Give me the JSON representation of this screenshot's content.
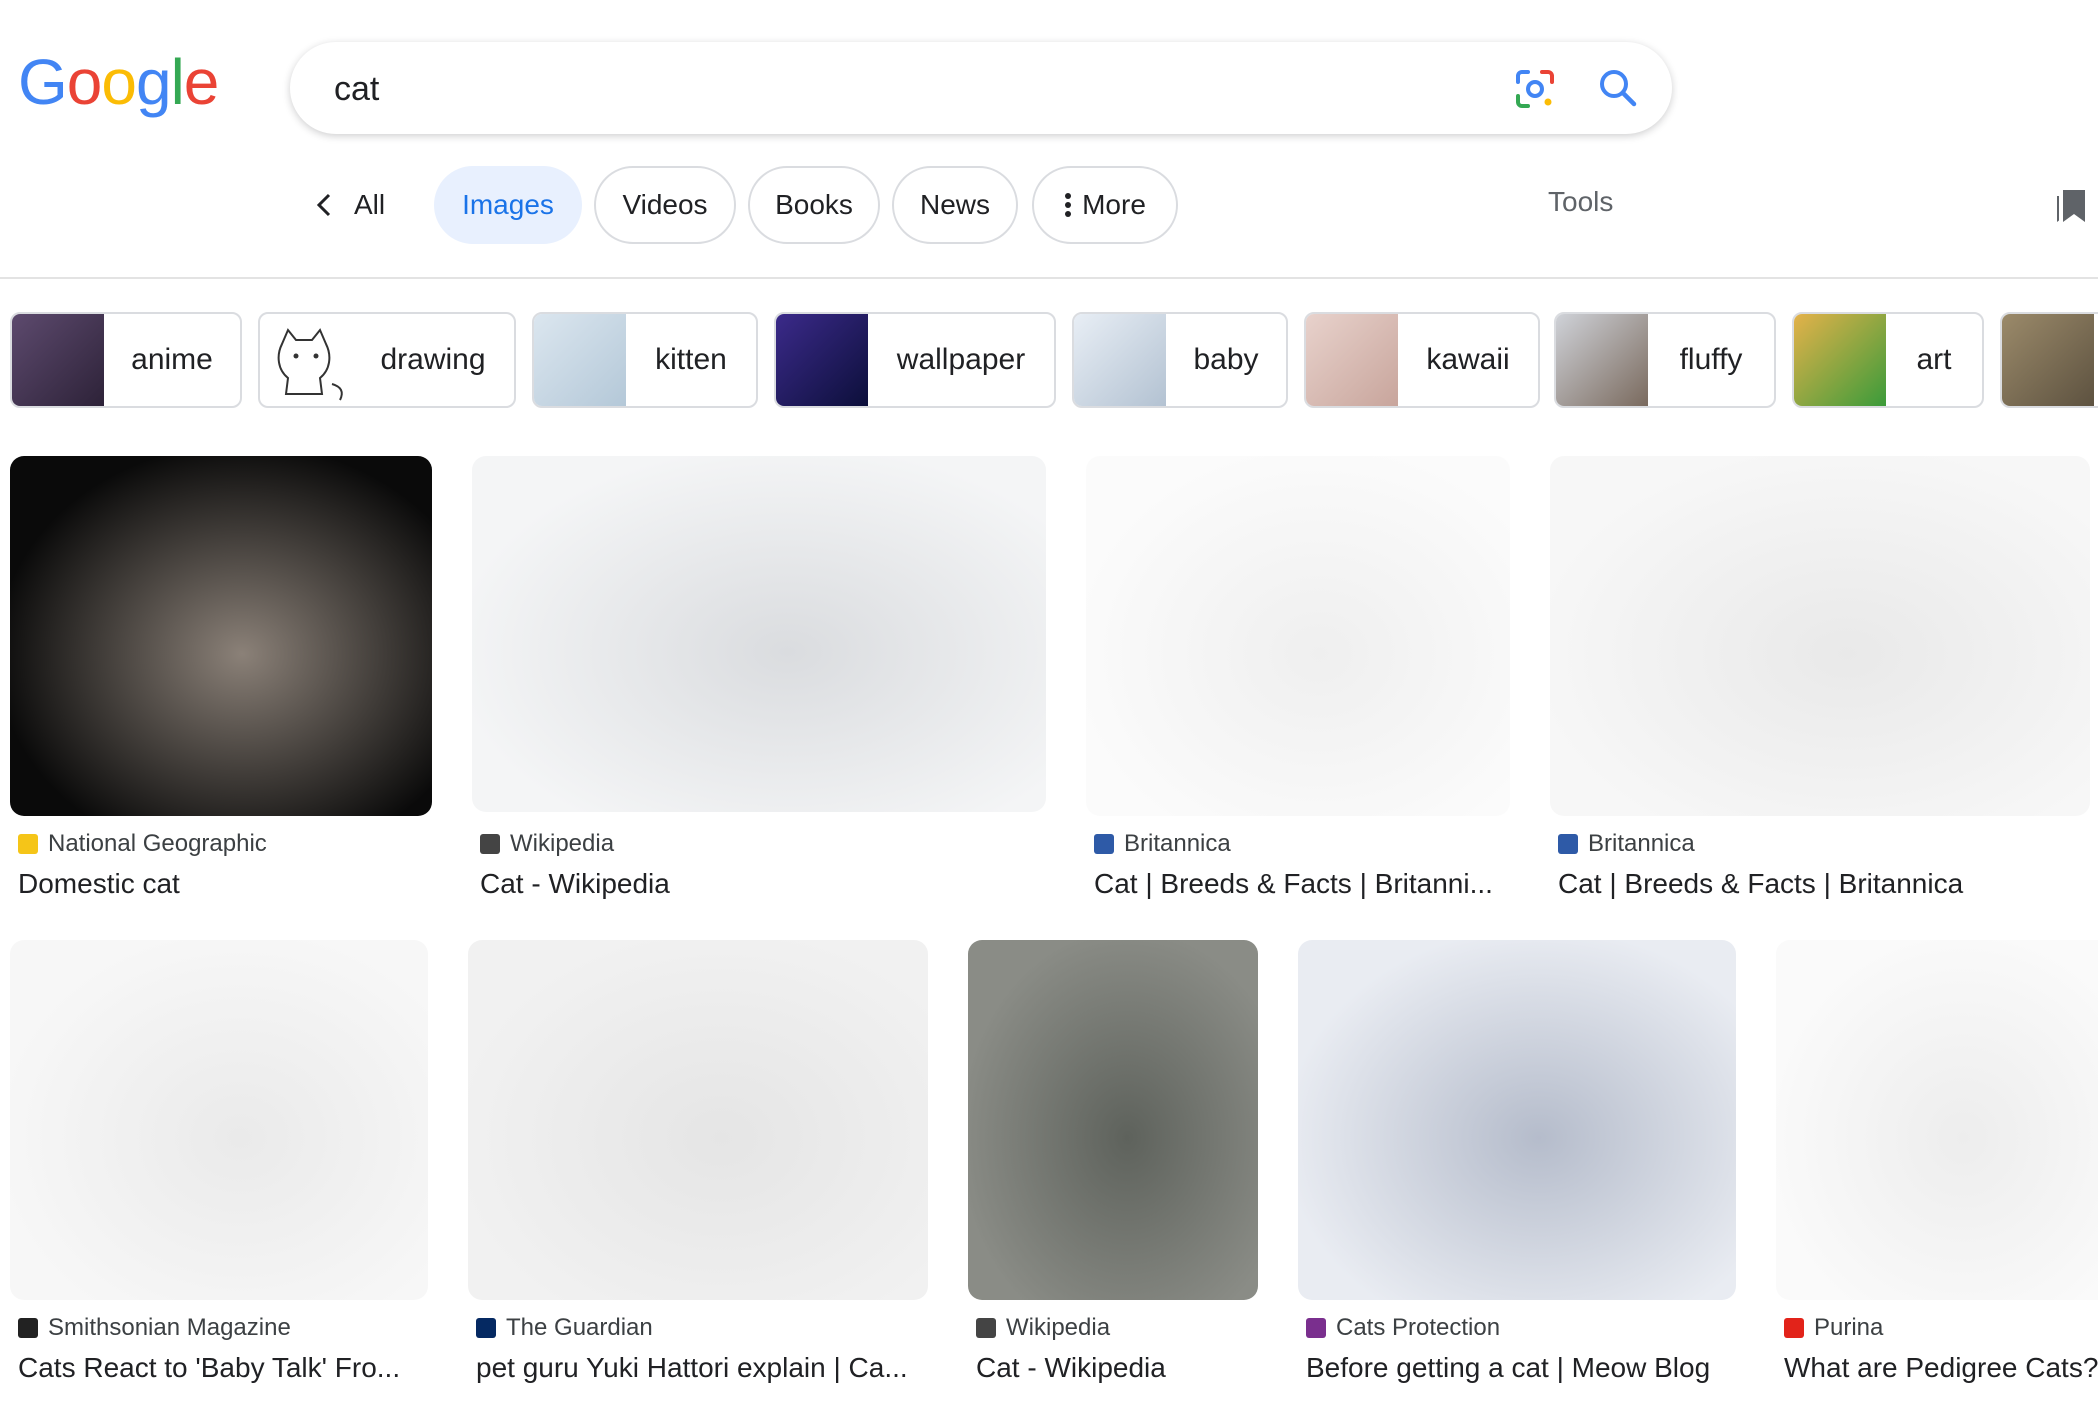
{
  "logo": {
    "letters": [
      "G",
      "o",
      "o",
      "g",
      "l",
      "e"
    ],
    "colors": [
      "#4285F4",
      "#EA4335",
      "#FBBC05",
      "#4285F4",
      "#34A853",
      "#EA4335"
    ]
  },
  "search": {
    "query": "cat"
  },
  "nav": {
    "back_all": "All",
    "tabs": [
      "Images",
      "Videos",
      "Books",
      "News",
      "More"
    ],
    "active": "Images",
    "tools": "Tools"
  },
  "chips": [
    {
      "label": "anime",
      "thumb_colors": [
        "#5d4a6e",
        "#2d2238"
      ]
    },
    {
      "label": "drawing",
      "thumb_colors": [
        "#ffffff",
        "#f1f1f1"
      ]
    },
    {
      "label": "kitten",
      "thumb_colors": [
        "#dbe6ef",
        "#b4c8d8"
      ]
    },
    {
      "label": "wallpaper",
      "thumb_colors": [
        "#3b2a8a",
        "#0c0f3a"
      ]
    },
    {
      "label": "baby",
      "thumb_colors": [
        "#e8eef5",
        "#b3c2d2"
      ]
    },
    {
      "label": "kawaii",
      "thumb_colors": [
        "#e8d2cc",
        "#c8a59c"
      ]
    },
    {
      "label": "fluffy",
      "thumb_colors": [
        "#cfd2d8",
        "#7a6a5e"
      ]
    },
    {
      "label": "art",
      "thumb_colors": [
        "#e4b24a",
        "#3b9b3a"
      ]
    },
    {
      "label": "",
      "thumb_colors": [
        "#9b8a6a",
        "#5d5240"
      ]
    }
  ],
  "results": [
    {
      "source": "National Geographic",
      "title": "Domestic cat",
      "icon_color": "#f5c518",
      "img_colors": [
        "#0a0a0a",
        "#8b8178"
      ]
    },
    {
      "source": "Wikipedia",
      "title": "Cat - Wikipedia",
      "icon_color": "#444444",
      "img_colors": [
        "#f4f5f6",
        "#dadcdf"
      ]
    },
    {
      "source": "Britannica",
      "title": "Cat | Breeds & Facts | Britanni...",
      "icon_color": "#2e5aa7",
      "img_colors": [
        "#fbfbfb",
        "#efefef"
      ]
    },
    {
      "source": "Britannica",
      "title": "Cat | Breeds & Facts | Britannica",
      "icon_color": "#2e5aa7",
      "img_colors": [
        "#f7f7f7",
        "#e9e9e9"
      ]
    },
    {
      "source": "Smithsonian Magazine",
      "title": "Cats React to 'Baby Talk' Fro...",
      "icon_color": "#222222",
      "img_colors": [
        "#f7f7f7",
        "#eaeaea"
      ]
    },
    {
      "source": "The Guardian",
      "title": "pet guru Yuki Hattori explain | Ca...",
      "icon_color": "#052962",
      "img_colors": [
        "#f1f1f1",
        "#e5e5e5"
      ]
    },
    {
      "source": "Wikipedia",
      "title": "Cat - Wikipedia",
      "icon_color": "#444444",
      "img_colors": [
        "#8a8c86",
        "#5e625c"
      ]
    },
    {
      "source": "Cats Protection",
      "title": "Before getting a cat | Meow Blog",
      "icon_color": "#7a2f8e",
      "img_colors": [
        "#e9ecf2",
        "#b5bccb"
      ]
    },
    {
      "source": "Purina",
      "title": "What are Pedigree Cats?",
      "icon_color": "#e2231a",
      "img_colors": [
        "#fafafa",
        "#ededed"
      ]
    }
  ]
}
